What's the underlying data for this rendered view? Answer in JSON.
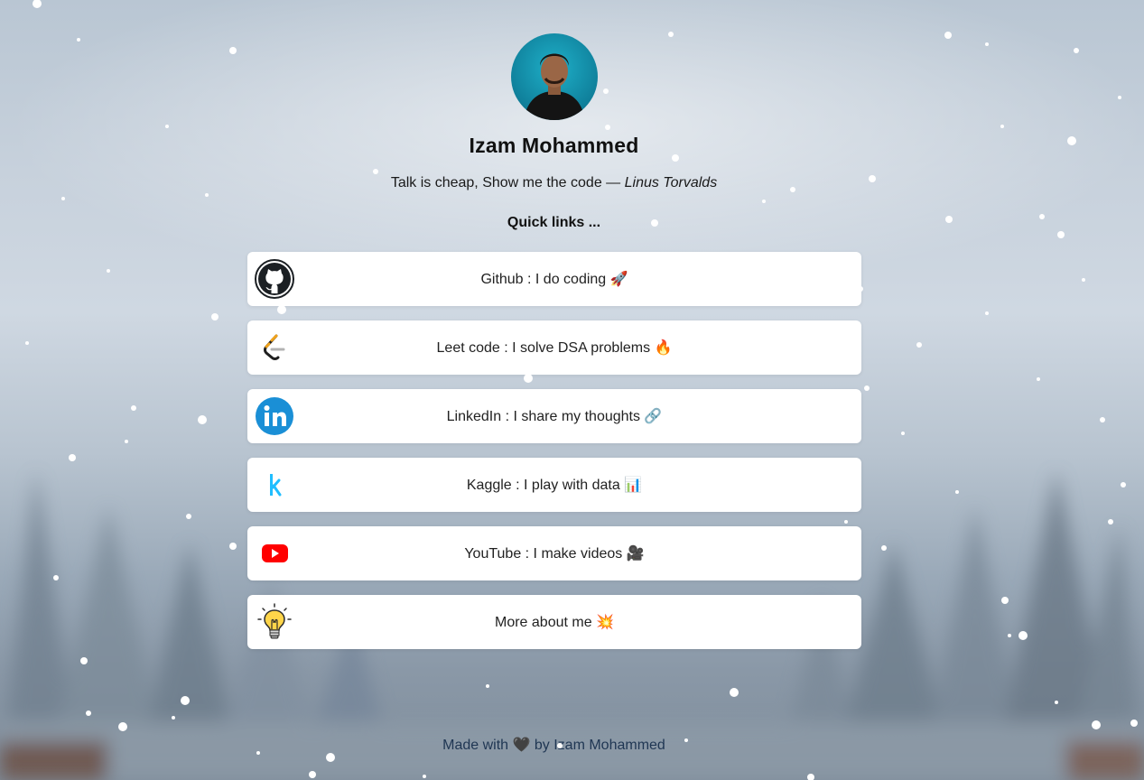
{
  "profile": {
    "name": "Izam Mohammed",
    "quote_text": "Talk is cheap, Show me the code — ",
    "quote_author": "Linus Torvalds",
    "quick_links_heading": "Quick links ..."
  },
  "links": [
    {
      "label": "Github : I do coding 🚀",
      "icon": "github-icon"
    },
    {
      "label": "Leet code : I solve DSA problems 🔥",
      "icon": "leetcode-icon"
    },
    {
      "label": "LinkedIn : I share my thoughts 🔗",
      "icon": "linkedin-icon"
    },
    {
      "label": "Kaggle : I play with data 📊",
      "icon": "kaggle-icon"
    },
    {
      "label": "YouTube : I make videos 🎥",
      "icon": "youtube-icon"
    },
    {
      "label": "More about me 💥",
      "icon": "lightbulb-icon"
    }
  ],
  "footer": {
    "text": "Made with 🖤 by Izam Mohammed"
  },
  "colors": {
    "card_background": "#ffffff",
    "footer_text": "#1f3653",
    "avatar_background": "#138aa6"
  }
}
